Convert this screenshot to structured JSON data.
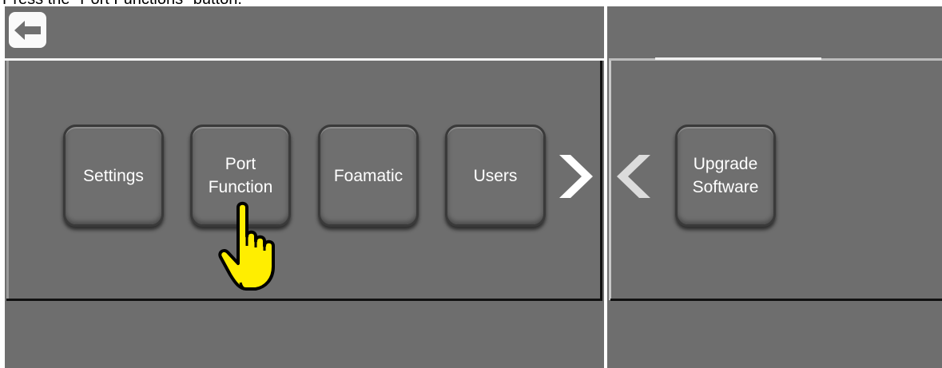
{
  "instruction": "Press the \"Port Functions\" button.",
  "header": {
    "back_icon": "arrow-left-icon"
  },
  "main_page": {
    "buttons": [
      {
        "label": "Settings"
      },
      {
        "label": "Port\nFunction"
      },
      {
        "label": "Foamatic"
      },
      {
        "label": "Users"
      }
    ],
    "next_icon": "chevron-right-icon"
  },
  "next_page": {
    "prev_icon": "chevron-left-icon",
    "buttons": [
      {
        "label": "Upgrade\nSoftware"
      }
    ]
  },
  "pointer_icon": "pointing-hand-icon",
  "colors": {
    "panel": "#6e6e6e",
    "button_text": "#ffffff",
    "hand_fill": "#ffee00"
  }
}
